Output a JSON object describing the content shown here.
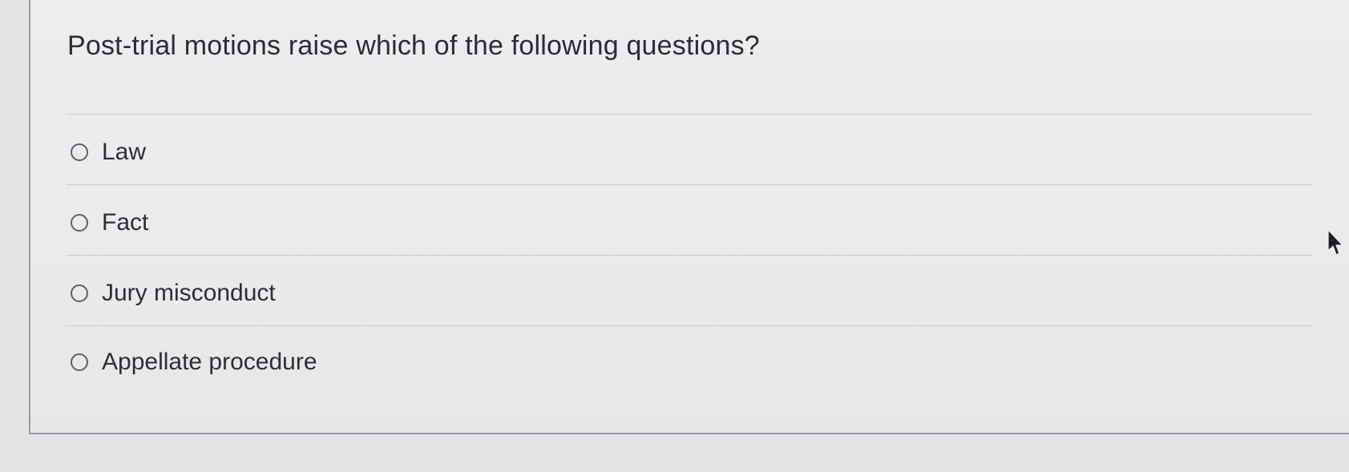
{
  "question": {
    "text": "Post-trial motions raise which of the following questions?"
  },
  "options": [
    {
      "label": "Law",
      "selected": false
    },
    {
      "label": "Fact",
      "selected": false
    },
    {
      "label": "Jury misconduct",
      "selected": false
    },
    {
      "label": "Appellate procedure",
      "selected": false
    }
  ],
  "icons": {
    "radio": "radio-button-empty",
    "cursor": "mouse-pointer-icon"
  },
  "colors": {
    "page_background": "#e3e4e6",
    "card_background": "#ecedef",
    "card_border": "#9a9ca0",
    "divider": "#c9cbce",
    "text": "#2d2f33"
  }
}
